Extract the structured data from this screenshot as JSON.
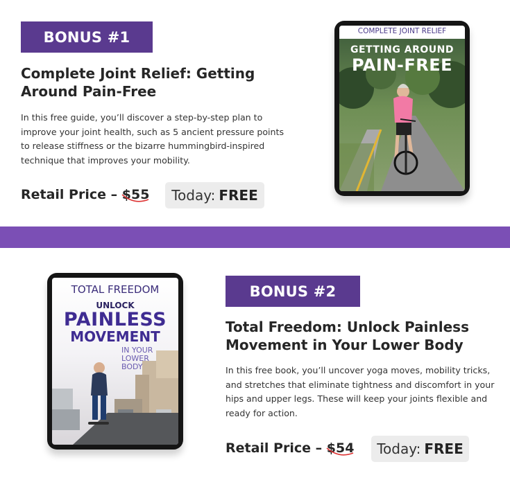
{
  "bonus1": {
    "badge": "BONUS #1",
    "title": "Complete Joint Relief: Getting Around Pain-Free",
    "description": "In this free guide, you’ll discover a step-by-step plan to improve your joint health, such as 5 ancient pressure points to release stiffness or the bizarre hummingbird-inspired technique that improves your mobility.",
    "price_label": "Retail Price – ",
    "old_price": "$55",
    "today_label": "Today:",
    "today_value": "FREE",
    "cover": {
      "top_line": "COMPLETE JOINT RELIEF",
      "line2": "GETTING AROUND",
      "line3": "PAIN-FREE"
    }
  },
  "bonus2": {
    "badge": "BONUS #2",
    "title": "Total Freedom: Unlock Painless Movement in Your Lower Body",
    "description": "In this free book, you’ll uncover yoga moves, mobility tricks, and stretches that eliminate tightness and discomfort in your hips and upper legs. These will keep your joints flexible and ready for action.",
    "price_label": "Retail Price – ",
    "old_price": "$54",
    "today_label": "Today:",
    "today_value": "FREE",
    "cover": {
      "top_line": "TOTAL FREEDOM",
      "line2": "UNLOCK",
      "line3": "PAINLESS",
      "line4": "MOVEMENT",
      "line5": "IN YOUR",
      "line6": "LOWER",
      "line7": "BODY"
    }
  },
  "colors": {
    "badge": "#5a3a8f",
    "divider": "#7b4fb5",
    "strike": "#d33",
    "today_bg": "#ececec"
  }
}
